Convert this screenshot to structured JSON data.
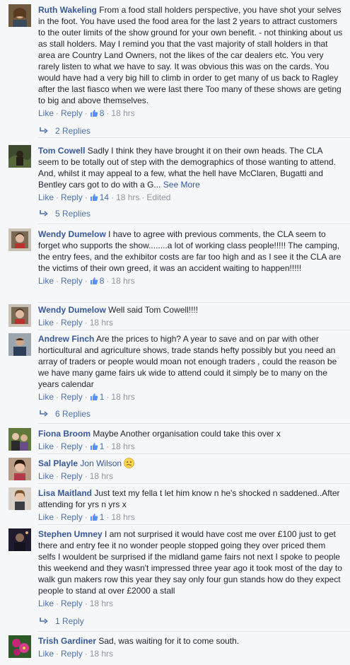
{
  "ui": {
    "like_label": "Like",
    "reply_label": "Reply",
    "dot": "·",
    "see_more": "See More"
  },
  "comments": [
    {
      "author": "Ruth Wakeling",
      "text": "From a food stall holders perspective, you have shot your selves in the foot. You have used the food area for the last 2 years to attract customers to the outer limits of the show ground for your own benefit. - not thinking about us as stall holders. May I remind you that the vast majority of stall holders in that area are Country Land Owners, not the likes of the car dealers etc. You very rarely listen to what we have to say. It was obvious this was on the cards. You would have had a very big hill to climb in order to get many of us back to Ragley after the last fiasco when we were last there Too many of these shows are geting to big and above themselves.",
      "likes": "8",
      "time": "18 hrs",
      "replies": "2 Replies"
    },
    {
      "author": "Tom Cowell",
      "text": "Sadly I think they have brought it on their own heads. The CLA seem to be totally out of step with the demographics of those wanting to attend. And, whilst it may appeal to a few, what the hell have McClaren, Bugatti and Bentley cars got to do with a G...",
      "likes": "14",
      "time": "18 hrs",
      "edited": "Edited",
      "replies": "5 Replies"
    },
    {
      "author": "Wendy Dumelow",
      "text": "I have to agree with previous comments, the CLA seem to forget who supports the show........a lot of working class people!!!!! The camping, the entry fees, and the exhibitor costs are far too high and as I see it the CLA are the victims of their own greed, it was an accident waiting to happen!!!!!",
      "likes": "8",
      "time": "18 hrs"
    },
    {
      "author": "Wendy Dumelow",
      "text": "Well said Tom Cowell!!!!",
      "time": "18 hrs"
    },
    {
      "author": "Andrew Finch",
      "text": "Are the prices to high? A year to save and on par with other horticultural and agriculture shows, trade stands hefty possibly but you need an array of traders or people would moan not enough traders , could the reason be we have many game fairs uk wide to attend could it simply be to many on the years calendar",
      "likes": "1",
      "time": "18 hrs",
      "replies": "6 Replies"
    },
    {
      "author": "Fiona Broom",
      "text": "Maybe Another organisation could take this over x",
      "likes": "1",
      "time": "18 hrs"
    },
    {
      "author": "Sal Playle",
      "text": "Jon Wilson",
      "emoji": "confused-face",
      "time": "18 hrs"
    },
    {
      "author": "Lisa Maitland",
      "text": "Just text my fella t let him know n he's shocked n saddened..After attending for yrs n yrs x",
      "likes": "1",
      "time": "18 hrs"
    },
    {
      "author": "Stephen Umney",
      "text": "I am not surprised it would have cost me over £100 just to get there and entry fee it no wonder people stopped going they over priced them selfs I wouldent be surprised if the midland game fairs not next I spoke to people this weekend and they wasn't impressed three year ago it took most of the day to walk gun makers row this year they say only four gun stands how do they expect people to stand at over £2000 a stall",
      "time": "18 hrs",
      "replies": "1 Reply"
    },
    {
      "author": "Trish Gardiner",
      "text": "Sad, was waiting for it to come south.",
      "time": "18 hrs"
    }
  ],
  "colors": {
    "name": "#365899",
    "link": "#4b6fa7",
    "meta": "#90949c",
    "text": "#1d2129",
    "background": "#f6f7f9",
    "like_badge": "#5890ff"
  }
}
